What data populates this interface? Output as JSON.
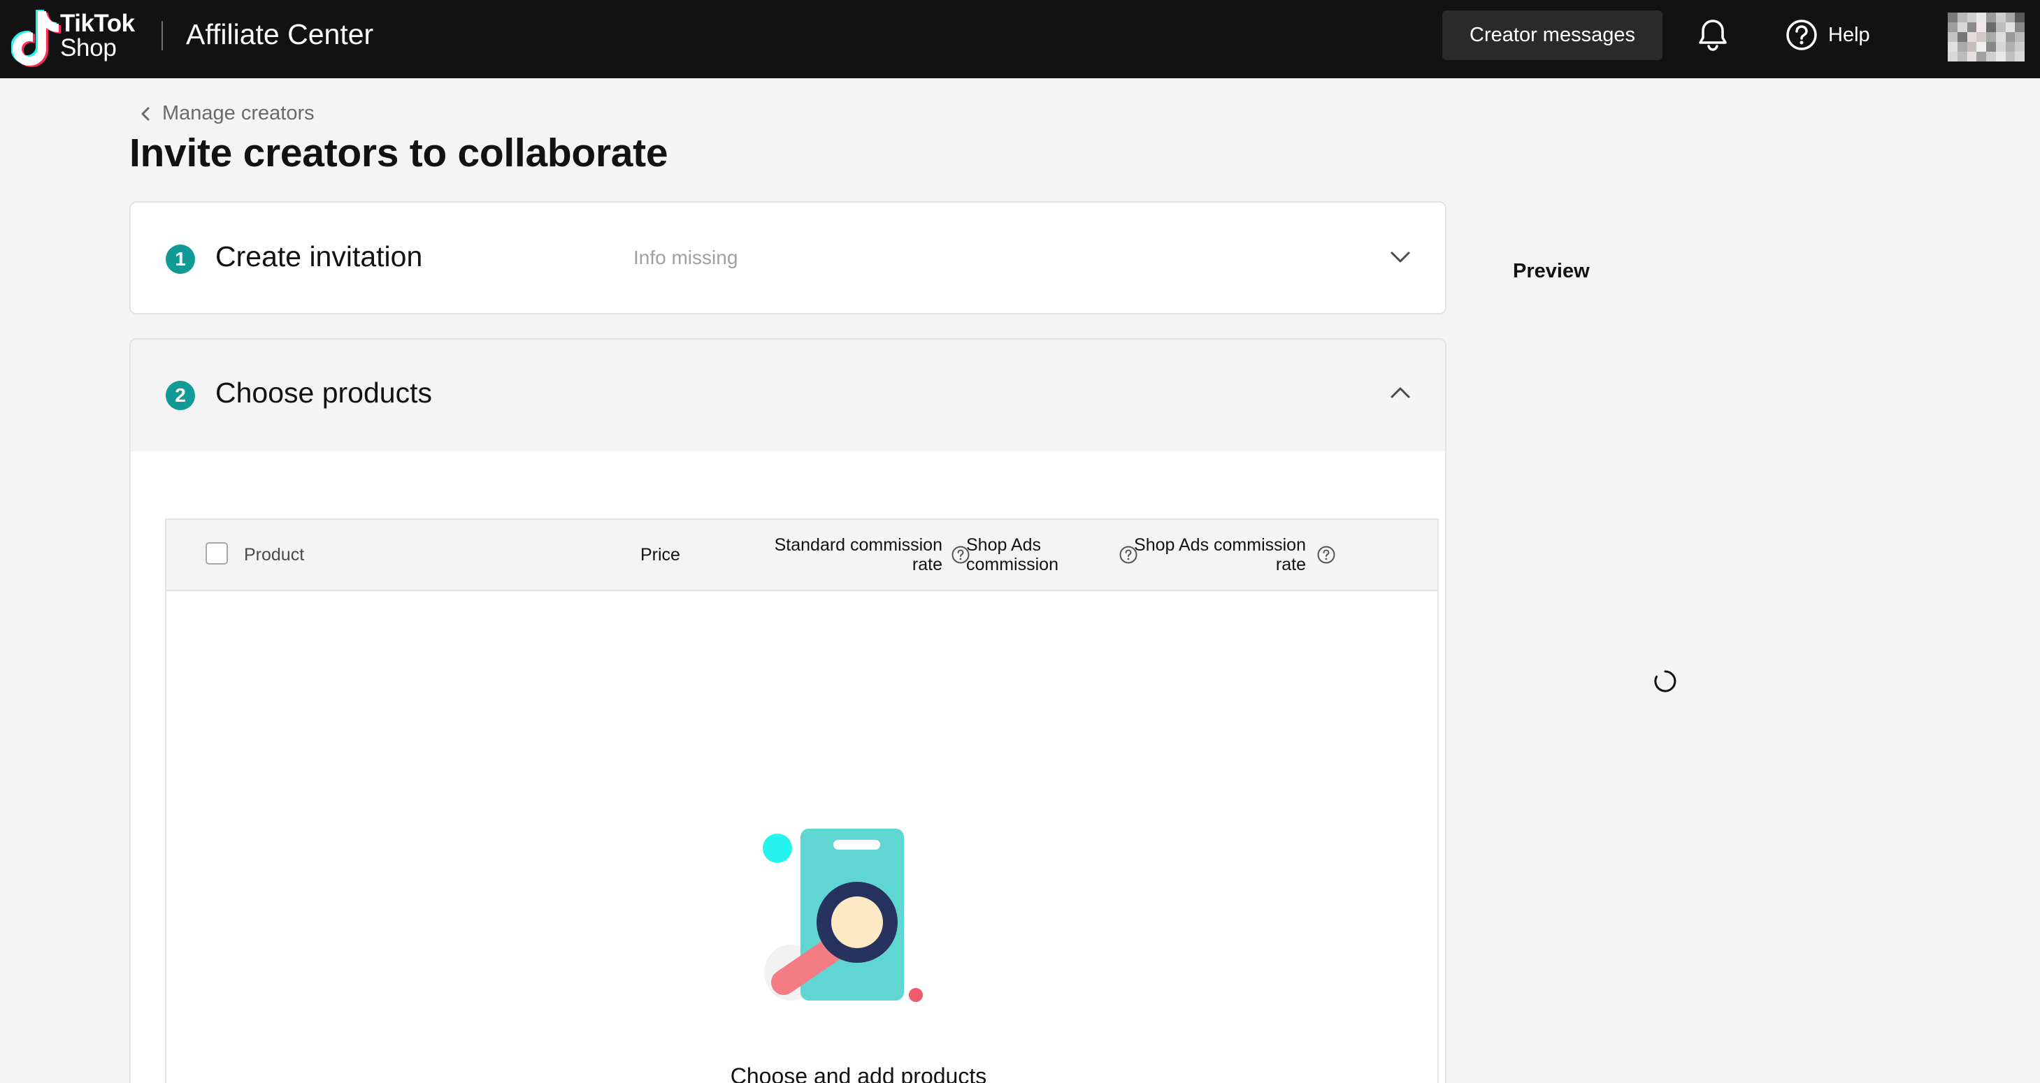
{
  "header": {
    "logo_line1": "TikTok",
    "logo_line2": "Shop",
    "app_title": "Affiliate Center",
    "creator_messages_label": "Creator messages",
    "help_label": "Help",
    "bell_icon": "bell-icon",
    "help_icon": "question-circle-icon"
  },
  "breadcrumb": {
    "back_label": "Manage creators"
  },
  "page": {
    "title": "Invite creators to collaborate"
  },
  "steps": [
    {
      "number": "1",
      "title": "Create invitation",
      "status": "Info missing",
      "expanded": false
    },
    {
      "number": "2",
      "title": "Choose products",
      "expanded": true
    }
  ],
  "products_table": {
    "columns": {
      "product": "Product",
      "price": "Price",
      "standard_line1": "Standard commission",
      "standard_line2": "rate",
      "ads_line1": "Shop Ads",
      "ads_line2": "commission",
      "ads_rate_line1": "Shop Ads commission",
      "ads_rate_line2": "rate"
    },
    "empty_message": "Choose and add products"
  },
  "preview": {
    "label": "Preview"
  },
  "colors": {
    "header_bg": "#121212",
    "accent_teal": "#119a96",
    "tiktok_cyan": "#25f4ee",
    "tiktok_red": "#fe2c55"
  }
}
